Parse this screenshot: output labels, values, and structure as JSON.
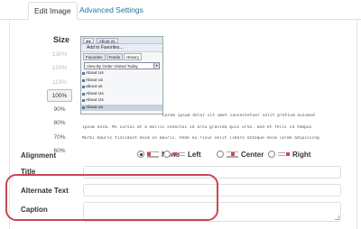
{
  "tabs": [
    {
      "label": "Edit Image",
      "active": true
    },
    {
      "label": "Advanced Settings",
      "active": false
    }
  ],
  "size": {
    "label": "Size",
    "options": [
      "130%",
      "120%",
      "110%",
      "100%",
      "90%",
      "80%",
      "70%",
      "60%"
    ],
    "selected": "100%"
  },
  "preview": {
    "toolbar_button": "About us",
    "add_to_favorites": "Add to Favorites...",
    "tabs": [
      "Favorites",
      "Feeds",
      "History"
    ],
    "active_tab": "History",
    "dropdown": "View By Order Visited Today",
    "items": [
      "About Us",
      "About us",
      "about us",
      "About Us",
      "About Us",
      "About us"
    ],
    "selected_item": 5
  },
  "lorem": {
    "side": "Lorem ipsum dolor sit amet consectetuer velit pretium euismod",
    "line1": "ipsum enim. Mi cursus at a mollis senectus id arcu gravida quis urna. Sed et felis id tempus",
    "line2": "Morbi mauris tincidunt enim In mauris. Pede eu risus velit libero natoque enim lorem adipiscing"
  },
  "alignment": {
    "label": "Alignment",
    "options": [
      "None",
      "Left",
      "Center",
      "Right"
    ],
    "selected": "None"
  },
  "fields": {
    "title_label": "Title",
    "alt_label": "Alternate Text",
    "caption_label": "Caption",
    "title_value": "",
    "alt_value": "",
    "caption_value": ""
  },
  "colors": {
    "link": "#21759b",
    "annotation": "#c9484f"
  }
}
